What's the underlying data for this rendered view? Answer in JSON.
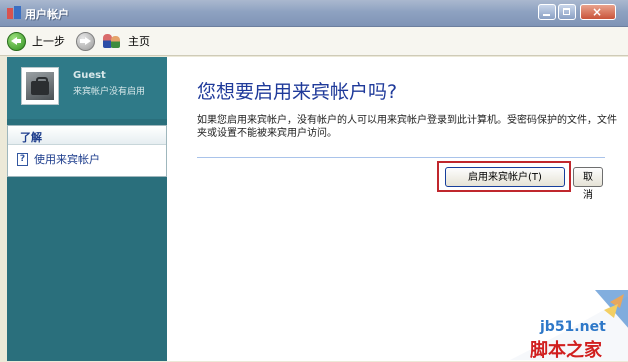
{
  "window": {
    "title": "用户帐户",
    "controls": {
      "minimize": "minimize",
      "maximize": "maximize",
      "close": "close"
    }
  },
  "nav": {
    "back_label": "上一步",
    "home_label": "主页"
  },
  "sidebar": {
    "account_name": "Guest",
    "account_status": "来宾帐户没有启用",
    "learn_title": "了解",
    "learn_link": "使用来宾帐户"
  },
  "main": {
    "heading": "您想要启用来宾帐户吗?",
    "description": "如果您启用来宾帐户，没有帐户的人可以用来宾帐户登录到此计算机。受密码保护的文件，文件夹或设置不能被来宾用户访问。",
    "enable_button": "启用来宾帐户(T)",
    "cancel_button": "取消"
  },
  "watermark": {
    "site": "jb51.net",
    "name": "脚本之家"
  },
  "colors": {
    "accent_blue": "#1f3a9a",
    "sidebar_teal": "#2a6f7c",
    "highlight_red": "#c0272d"
  }
}
